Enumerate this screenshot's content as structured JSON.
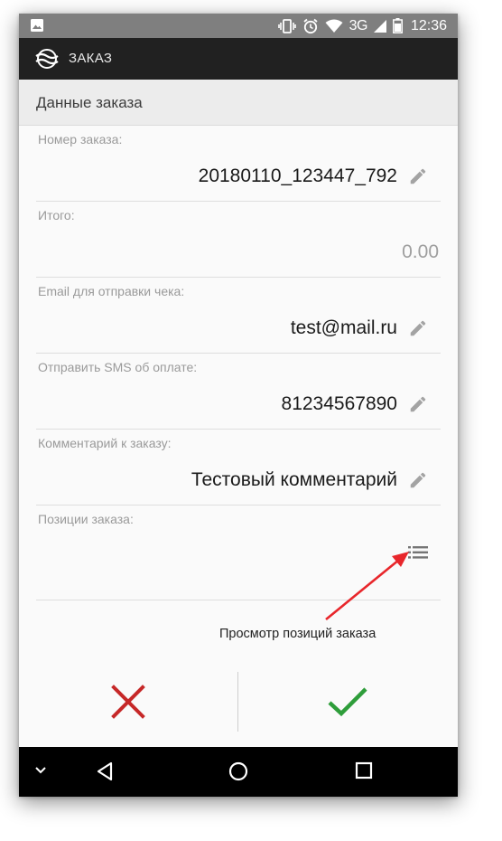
{
  "status_bar": {
    "network": "3G",
    "time": "12:36",
    "icons": [
      "image-icon",
      "vibrate-icon",
      "alarm-icon",
      "wifi-icon",
      "signal-icon",
      "battery-icon"
    ]
  },
  "app_bar": {
    "title": "ЗАКАЗ",
    "logo": "app-logo-icon"
  },
  "section": {
    "title": "Данные заказа"
  },
  "fields": [
    {
      "label": "Номер заказа:",
      "value": "20180110_123447_792",
      "editable": true
    },
    {
      "label": "Итого:",
      "value": "0.00",
      "editable": false
    },
    {
      "label": "Email для отправки чека:",
      "value": "test@mail.ru",
      "editable": true
    },
    {
      "label": "Отправить SMS об оплате:",
      "value": "81234567890",
      "editable": true
    },
    {
      "label": "Комментарий к заказу:",
      "value": "Тестовый комментарий",
      "editable": true
    },
    {
      "label": "Позиции заказа:",
      "value": "",
      "action_icon": "list-icon"
    }
  ],
  "annotation": {
    "text": "Просмотр позиций заказа",
    "color": "#e8262b"
  },
  "actions": {
    "cancel_icon": "cross-icon",
    "cancel_color": "#c62828",
    "confirm_icon": "check-icon",
    "confirm_color": "#2e9d3a"
  },
  "nav_bar": {
    "buttons": [
      "chevron-down-icon",
      "back-icon",
      "home-icon",
      "recents-icon"
    ]
  }
}
